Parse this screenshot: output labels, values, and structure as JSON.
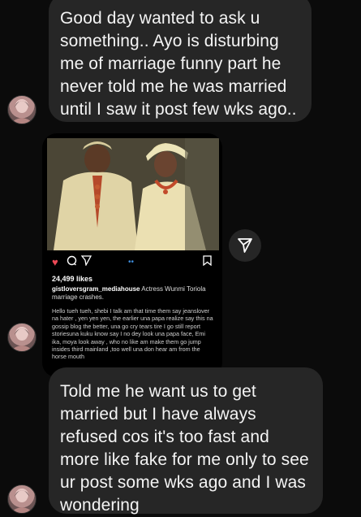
{
  "messages": [
    {
      "text": "Good day wanted to ask u\nsomething.. Ayo is disturbing\nme of marriage funny part he\nnever told me he was married\nuntil I saw it post few wks ago.."
    },
    {
      "text": "Told me he want us to get\nmarried but I have always\nrefused cos it's too fast and\nmore like fake for me only to see\nur post some wks ago and I was\nwondering"
    }
  ],
  "shared_post": {
    "likes": "24,499 likes",
    "username": "gistloversgram_mediahouse",
    "caption": "Actress Wunmi Toriola marriage crashes.",
    "comment": "Hello tueh tueh, shebi I talk am that time them say jeanslover na hater , yen yen yen, the earlier una papa realize say this na gossip blog the better, una go cry tears tire I go still report storiesuna kuku know say I no dey look una papa face, Emi ika, moya look away , who no like am make them go jump insides third mainland ,too well una don hear am from the horse mouth",
    "icons": {
      "like": "heart-icon",
      "comment": "comment-icon",
      "share": "send-icon",
      "save": "bookmark-icon"
    }
  },
  "colors": {
    "bubble": "#262626",
    "background": "#0b0b0b",
    "like": "#ed4956"
  }
}
